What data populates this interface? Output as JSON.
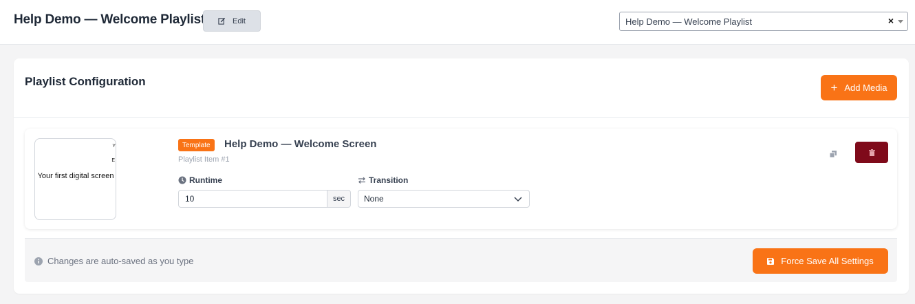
{
  "header": {
    "title": "Help Demo — Welcome Playlist",
    "edit_label": "Edit",
    "playlist_select": {
      "selected": "Help Demo — Welcome Playlist",
      "clear_symbol": "×"
    }
  },
  "config": {
    "title": "Playlist Configuration",
    "add_media_symbol": "+",
    "add_media_label": "Add Media"
  },
  "items": [
    {
      "thumbnail_text": "Your first digital screen",
      "thumbnail_edge_1": "Y",
      "thumbnail_edge_2": "E",
      "badge": "Template",
      "title": "Help Demo — Welcome Screen",
      "subtitle": "Playlist Item #1",
      "runtime_label": "Runtime",
      "runtime_value": "10",
      "runtime_unit": "sec",
      "transition_label": "Transition",
      "transition_value": "None"
    }
  ],
  "footer": {
    "note": "Changes are auto-saved as you type",
    "force_save_label": "Force Save All Settings"
  },
  "colors": {
    "accent": "#f97316",
    "danger": "#7f0a1a",
    "edit_button": "#dde1e7"
  },
  "icons": [
    "edit-icon",
    "plus-icon",
    "clock-icon",
    "exchange-icon",
    "chevron-down-icon",
    "copy-icon",
    "trash-icon",
    "info-icon",
    "save-icon"
  ]
}
